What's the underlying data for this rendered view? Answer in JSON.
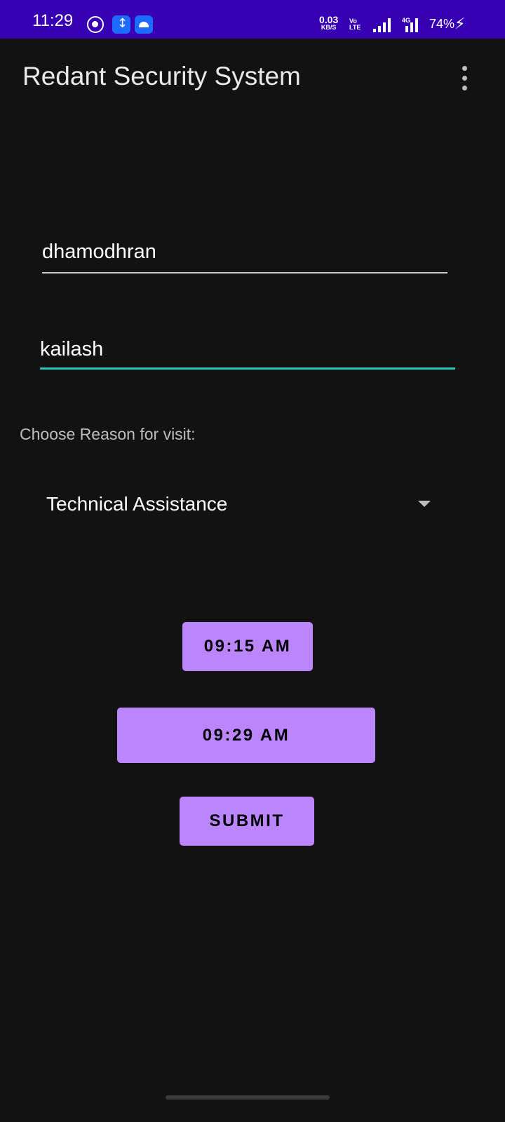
{
  "status_bar": {
    "time": "11:29",
    "net_speed_value": "0.03",
    "net_speed_unit": "KB/S",
    "volte_label_top": "Vo",
    "volte_label_bottom": "LTE",
    "network_type": "4G",
    "battery": "74%",
    "icons": [
      "whatsapp-icon",
      "usb-debug-icon",
      "android-icon",
      "signal-icon",
      "signal-4g-icon",
      "charging-icon"
    ],
    "bg_color": "#3700b3"
  },
  "app_bar": {
    "title": "Redant Security System",
    "menu_icon": "more-vert-icon"
  },
  "form": {
    "field1_value": "dhamodhran",
    "field2_value": "kailash",
    "reason_label": "Choose Reason for visit:",
    "reason_selected": "Technical Assistance",
    "start_time_button": "09:15 AM",
    "end_time_button": "09:29 AM",
    "submit_button": "SUBMIT"
  },
  "colors": {
    "background": "#121212",
    "button": "#bb86fc",
    "focus_underline": "#26c6b9"
  }
}
